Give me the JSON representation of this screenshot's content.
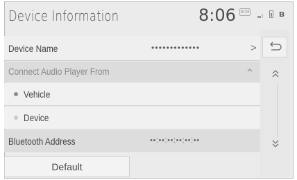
{
  "header": {
    "title": "Device Information",
    "clock": "8:06",
    "status_badge": "RCM",
    "bluetooth_icon": "bluetooth-icon"
  },
  "rows": {
    "device_name": {
      "label": "Device Name",
      "value": "•••••••••••••",
      "chevron": ">"
    },
    "connect_from": {
      "label": "Connect Audio Player From"
    },
    "vehicle": {
      "label": "Vehicle"
    },
    "device": {
      "label": "Device"
    },
    "bt_address": {
      "label": "Bluetooth Address",
      "value": "••:••:••:••:••:••"
    }
  },
  "buttons": {
    "default_label": "Default"
  },
  "colors": {
    "background": "#ebebeb",
    "row_light": "#f1f1f1",
    "row_dark": "#dcdcdc",
    "text": "#454545"
  }
}
